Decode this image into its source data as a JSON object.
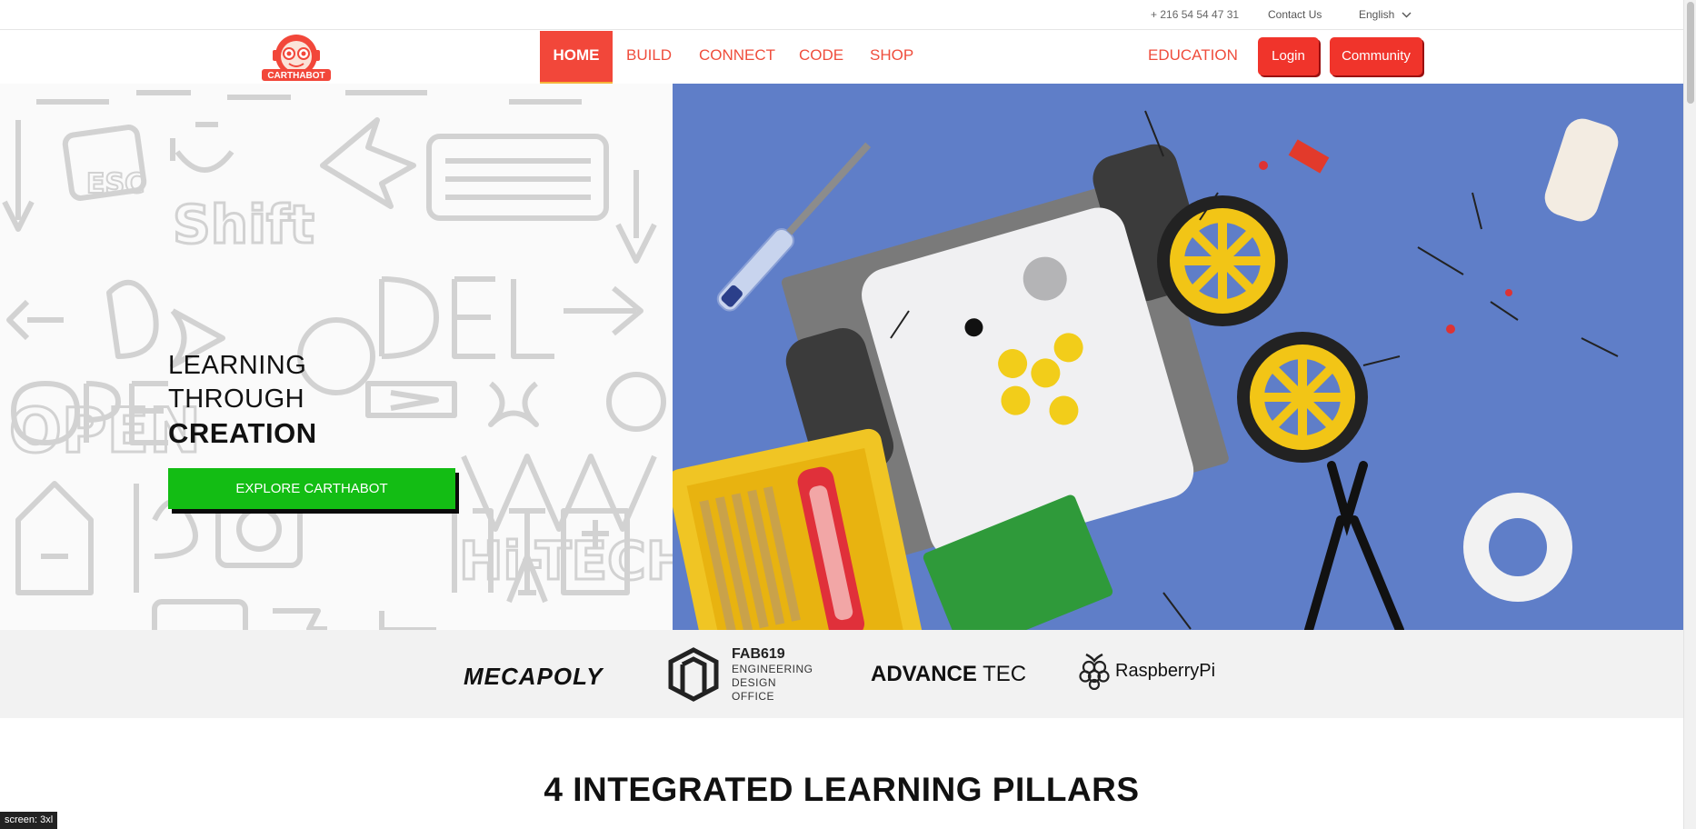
{
  "topbar": {
    "phone": "+ 216 54 54 47 31",
    "contact": "Contact Us",
    "language": "English"
  },
  "brand": {
    "name": "CARTHABOT",
    "accent": "#f2473a",
    "accent_dark": "#ef4d3c"
  },
  "nav": {
    "items": [
      "HOME",
      "BUILD",
      "CONNECT",
      "CODE",
      "SHOP"
    ],
    "active": "HOME",
    "education": "EDUCATION",
    "login": "Login",
    "community": "Community"
  },
  "hero": {
    "line1": "LEARNING",
    "line2": "THROUGH",
    "line3": "CREATION",
    "cta": "EXPLORE CARTHABOT",
    "cta_color": "#13bd14"
  },
  "partners": {
    "mecapoly": "MECAPOLY",
    "fab_title": "FAB619",
    "fab_line1": "ENGINEERING",
    "fab_line2": "DESIGN OFFICE",
    "advance_bold": "ADVANCE",
    "advance_rest": " TEC",
    "raspberry": "RaspberryPi"
  },
  "section": {
    "title": "4 INTEGRATED LEARNING PILLARS"
  },
  "debug": {
    "screen": "screen: 3xl"
  }
}
